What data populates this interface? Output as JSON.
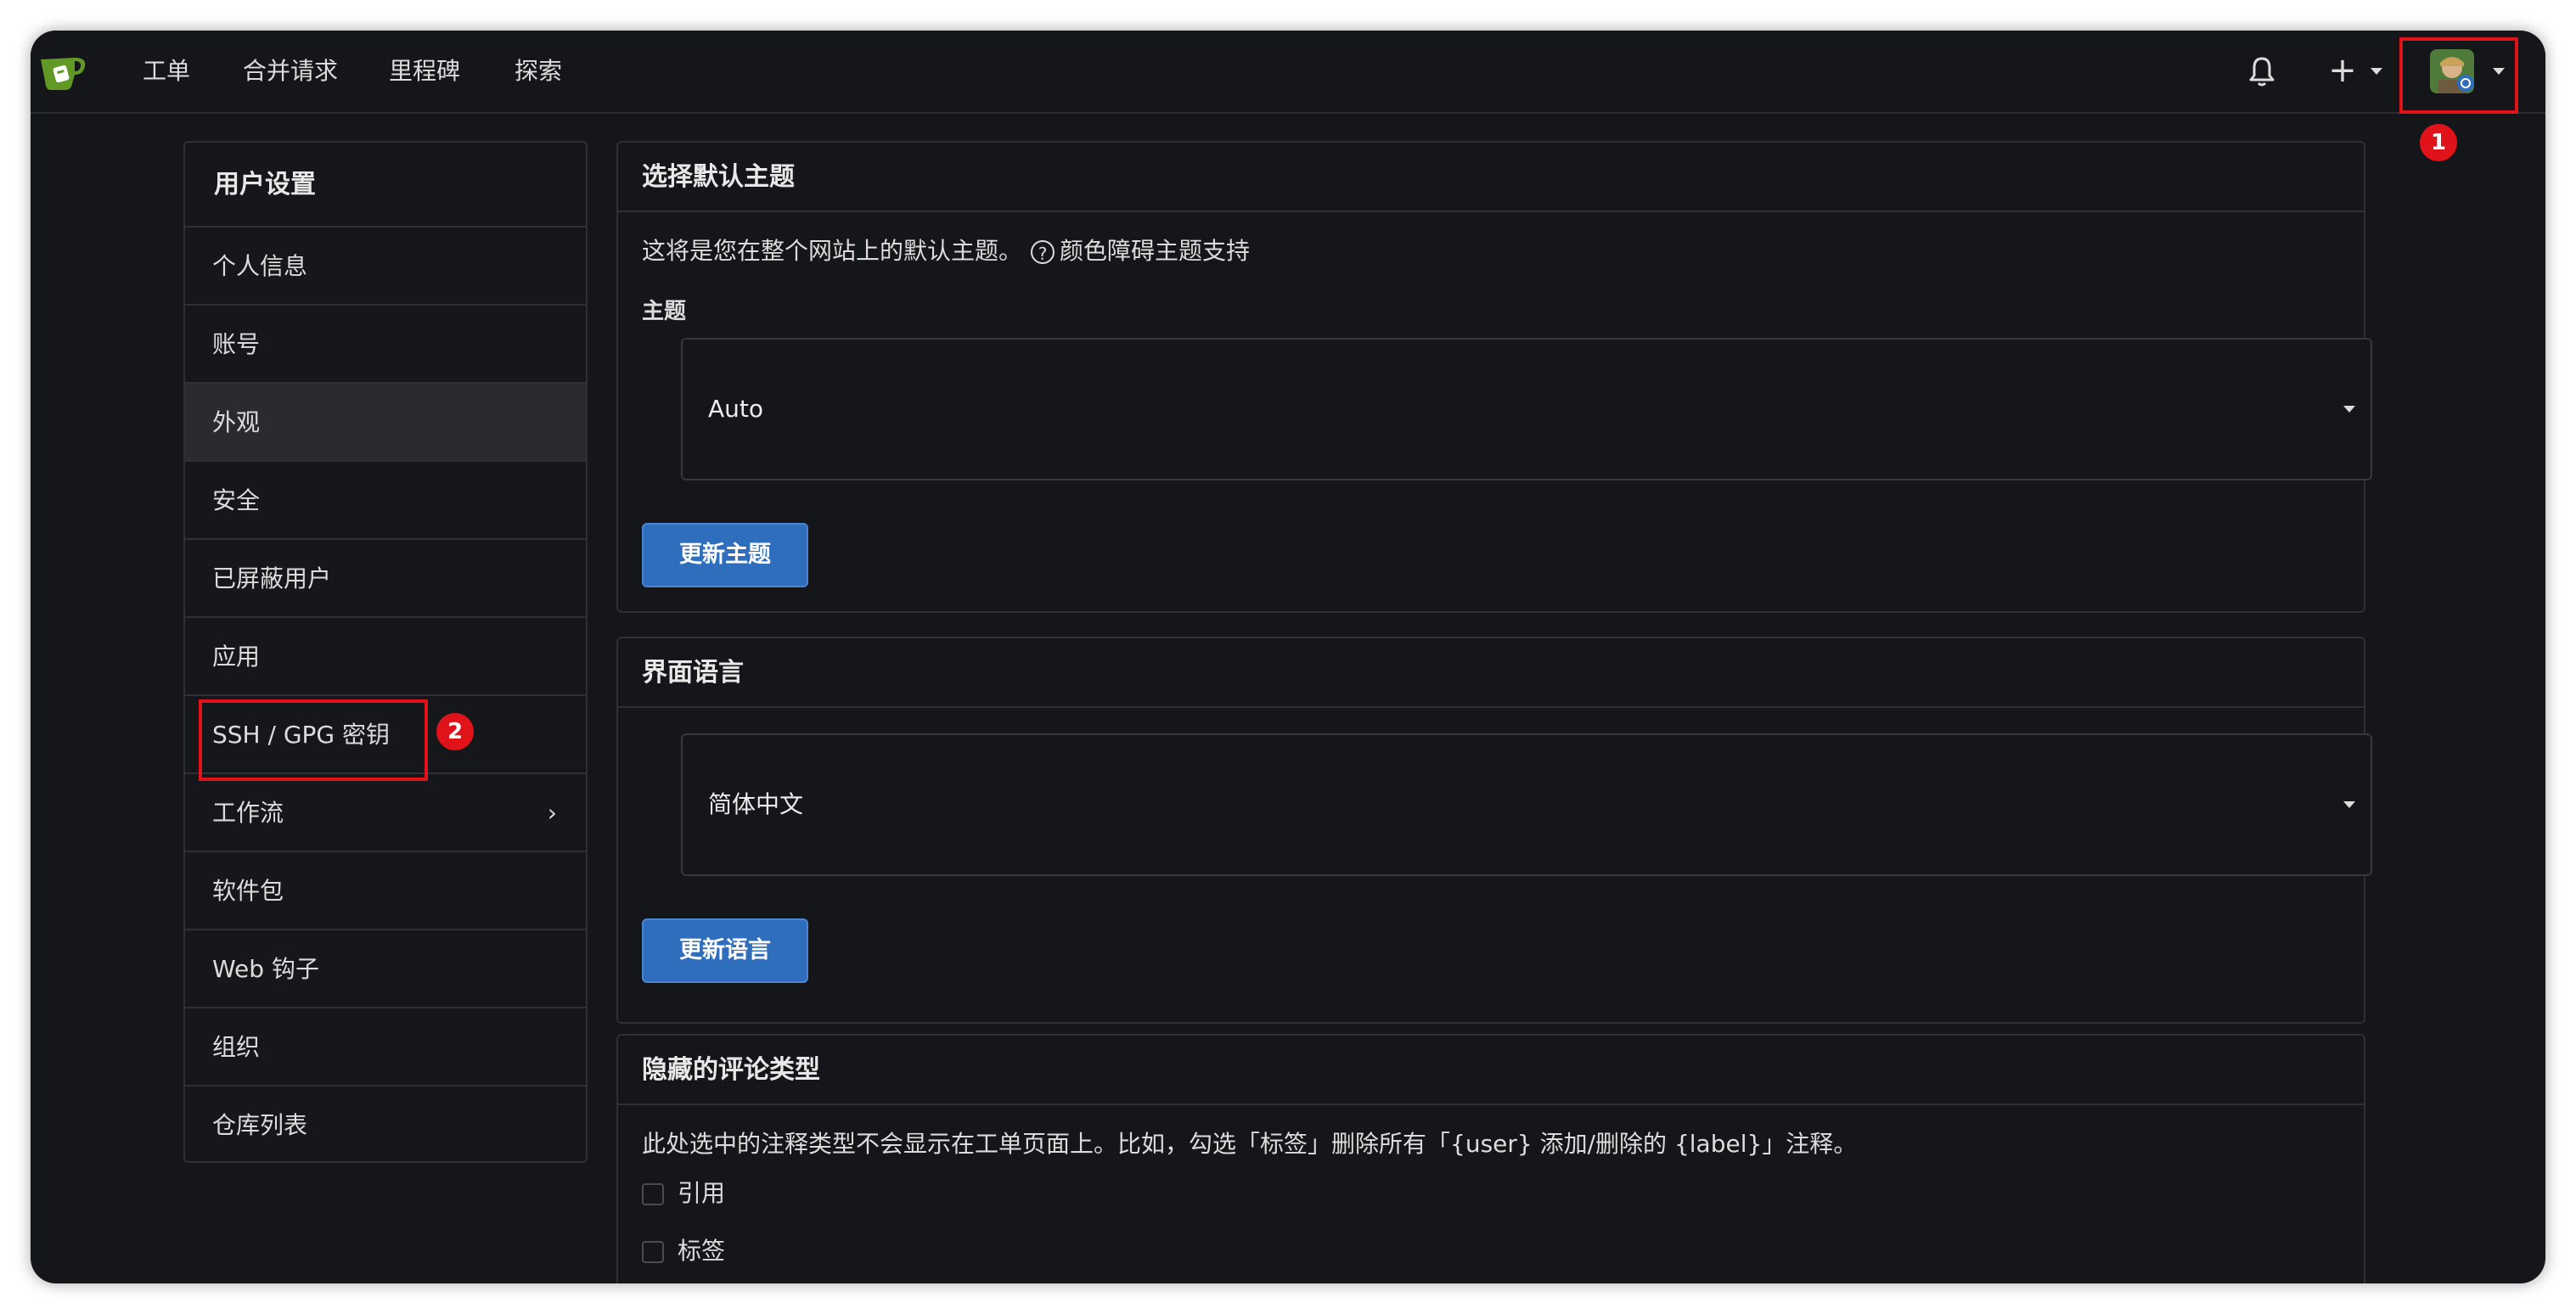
{
  "nav": {
    "links": [
      "工单",
      "合并请求",
      "里程碑",
      "探索"
    ]
  },
  "annotations": [
    "1",
    "2"
  ],
  "sidebar": {
    "title": "用户设置",
    "items": [
      {
        "label": "个人信息"
      },
      {
        "label": "账号"
      },
      {
        "label": "外观",
        "active": true
      },
      {
        "label": "安全"
      },
      {
        "label": "已屏蔽用户"
      },
      {
        "label": "应用"
      },
      {
        "label": "SSH / GPG 密钥"
      },
      {
        "label": "工作流",
        "has_submenu": true
      },
      {
        "label": "软件包"
      },
      {
        "label": "Web 钩子"
      },
      {
        "label": "组织"
      },
      {
        "label": "仓库列表"
      }
    ]
  },
  "theme": {
    "title": "选择默认主题",
    "description": "这将是您在整个网站上的默认主题。",
    "help_link": "颜色障碍主题支持",
    "field_label": "主题",
    "selected": "Auto",
    "button": "更新主题"
  },
  "language": {
    "title": "界面语言",
    "selected": "简体中文",
    "button": "更新语言"
  },
  "hidden_comments": {
    "title": "隐藏的评论类型",
    "description": "此处选中的注释类型不会显示在工单页面上。比如，勾选「标签」删除所有「{user} 添加/删除的 {label}」注释。",
    "options": [
      "引用",
      "标签"
    ]
  },
  "colors": {
    "accent_button": "#2f6dbd",
    "annotation_red": "#e0131a",
    "logo_green": "#609926"
  }
}
